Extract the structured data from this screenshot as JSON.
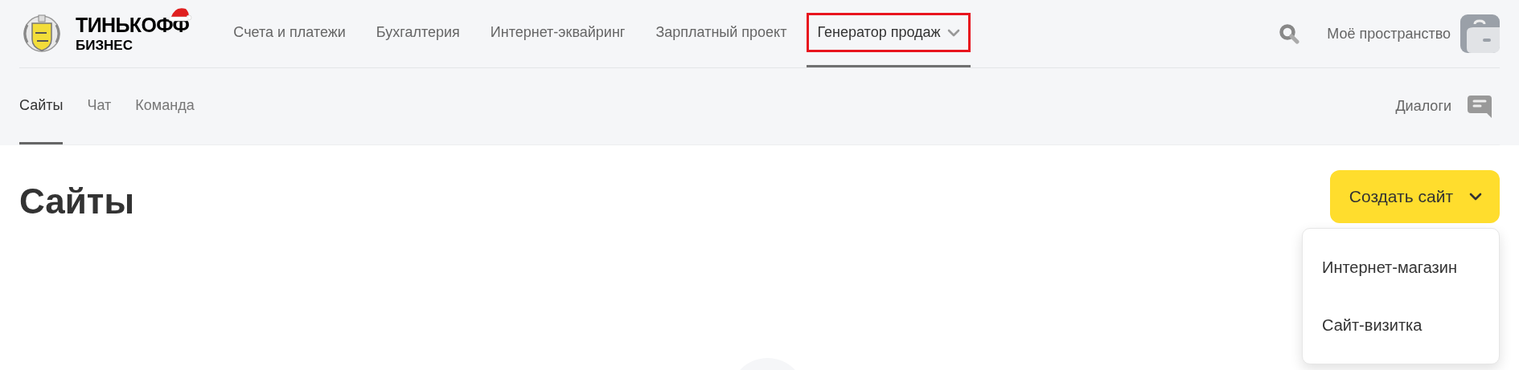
{
  "logo": {
    "title": "ТИНЬКОФФ",
    "subtitle": "БИЗНЕС"
  },
  "nav": [
    {
      "label": "Счета и платежи",
      "selected": false,
      "highlighted": false,
      "kind": "link"
    },
    {
      "label": "Бухгалтерия",
      "selected": false,
      "highlighted": false,
      "kind": "link"
    },
    {
      "label": "Интернет-эквайринг",
      "selected": false,
      "highlighted": false,
      "kind": "link"
    },
    {
      "label": "Зарплатный проект",
      "selected": false,
      "highlighted": false,
      "kind": "link"
    },
    {
      "label": "Генератор продаж",
      "selected": true,
      "highlighted": true,
      "kind": "dropdown"
    }
  ],
  "account": {
    "label": "Моё пространство"
  },
  "subnav": [
    {
      "label": "Сайты",
      "selected": true
    },
    {
      "label": "Чат",
      "selected": false
    },
    {
      "label": "Команда",
      "selected": false
    }
  ],
  "dialogs": {
    "label": "Диалоги"
  },
  "page_title": "Сайты",
  "create_button": {
    "label": "Создать сайт",
    "expanded": true
  },
  "create_menu": [
    "Интернет-магазин",
    "Сайт-визитка"
  ]
}
